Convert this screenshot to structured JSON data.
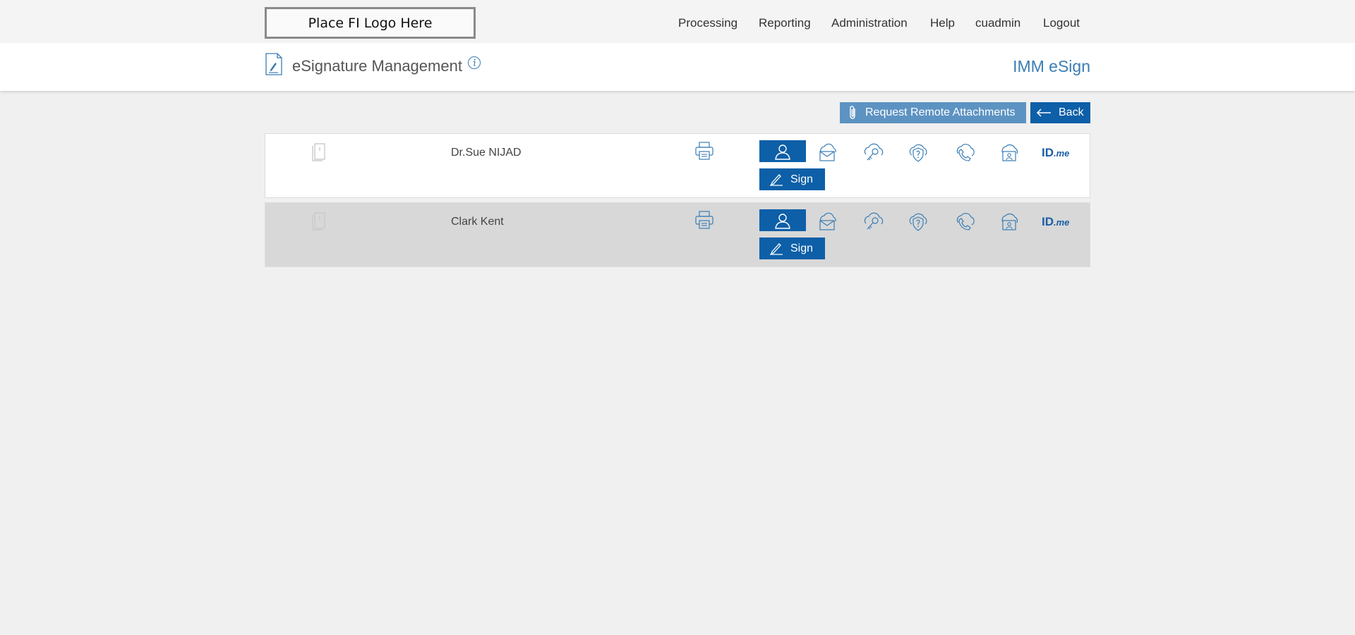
{
  "header": {
    "logo_text": "Place FI Logo Here",
    "nav": [
      {
        "label": "Processing"
      },
      {
        "label": "Reporting"
      },
      {
        "label": "Administration"
      },
      {
        "label": "Help"
      },
      {
        "label": "cuadmin"
      },
      {
        "label": "Logout"
      }
    ]
  },
  "titlebar": {
    "title": "eSignature Management",
    "title_icon": "document-sign-icon",
    "info_icon": "info-icon",
    "brand": "IMM eSign"
  },
  "toolbar": {
    "attach_label": "Request Remote Attachments",
    "attach_icon": "paperclip-icon",
    "back_label": "Back",
    "back_icon": "arrow-left-icon"
  },
  "signers": [
    {
      "name": "Dr.Sue NIJAD",
      "sign_label": "Sign",
      "idme_brand": "ID",
      "idme_suffix": ".me"
    },
    {
      "name": "Clark Kent",
      "sign_label": "Sign",
      "idme_brand": "ID",
      "idme_suffix": ".me"
    }
  ],
  "auth_icons": [
    "person-icon",
    "cloud-mail-icon",
    "cloud-key-icon",
    "cloud-question-icon",
    "cloud-phone-icon",
    "cloud-id-card-icon",
    "idme-logo"
  ],
  "colors": {
    "primary": "#0d5fa8",
    "secondary": "#5d93c2",
    "brand_text": "#3a7db5",
    "page_bg": "#f0f0f0",
    "row_alt_bg": "#d8d8d8"
  }
}
